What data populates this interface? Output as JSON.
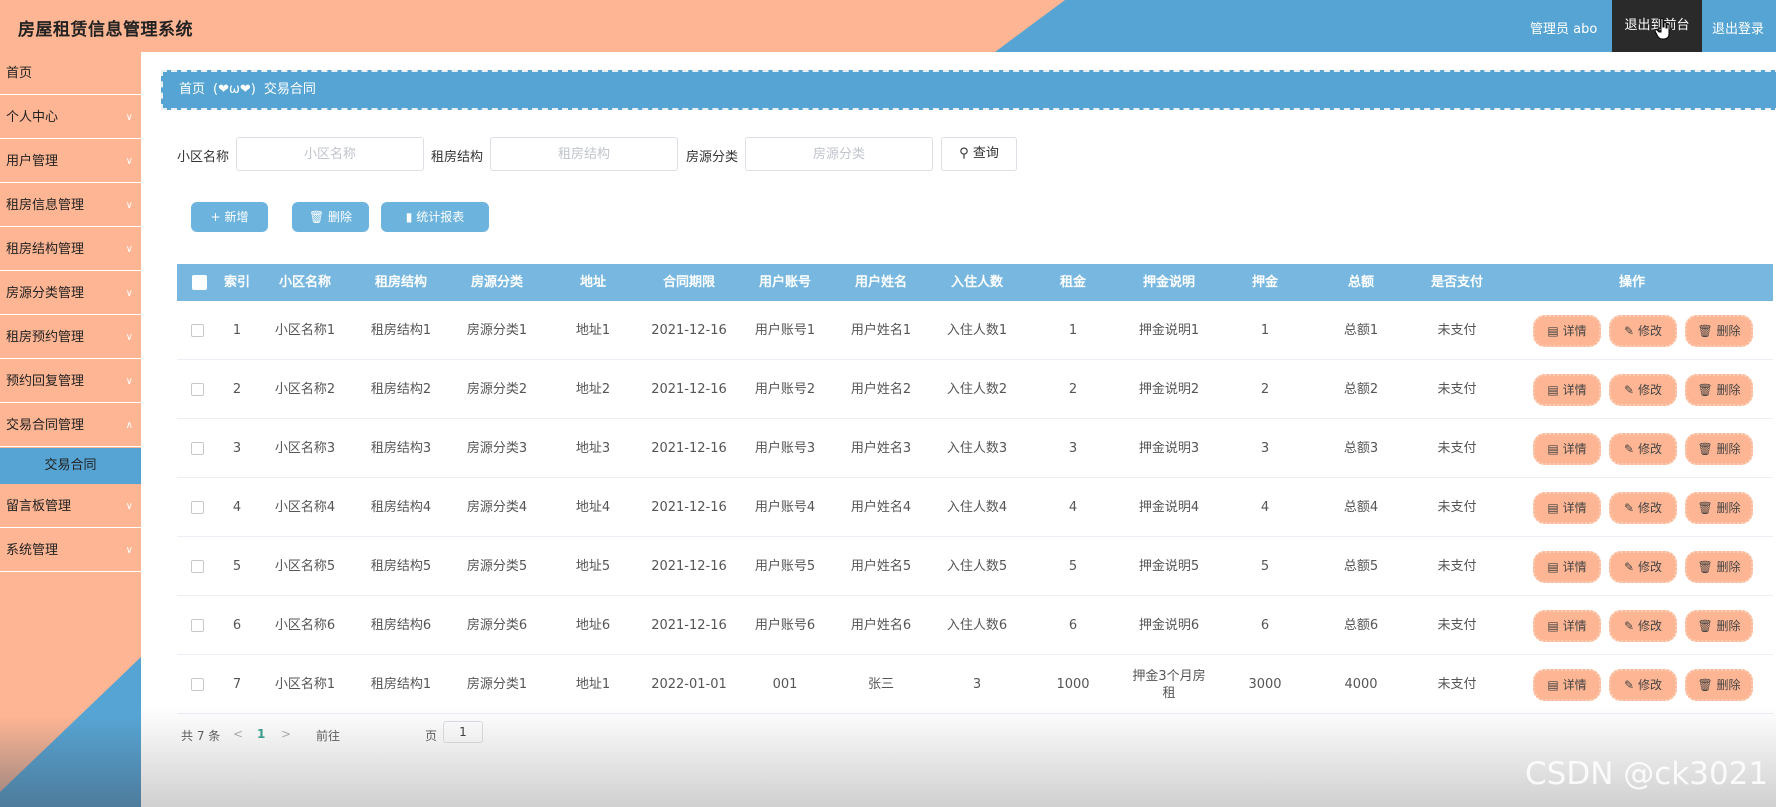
{
  "header": {
    "title": "房屋租赁信息管理系统",
    "admin_label": "管理员 abo",
    "backstage_label": "退出到前台",
    "logout_label": "退出登录"
  },
  "sidebar": {
    "items": [
      {
        "label": "首页"
      },
      {
        "label": "个人中心"
      },
      {
        "label": "用户管理"
      },
      {
        "label": "租房信息管理"
      },
      {
        "label": "租房结构管理"
      },
      {
        "label": "房源分类管理"
      },
      {
        "label": "租房预约管理"
      },
      {
        "label": "预约回复管理"
      },
      {
        "label": "交易合同管理"
      },
      {
        "label": "留言板管理"
      },
      {
        "label": "系统管理"
      }
    ],
    "active_sub": "交易合同"
  },
  "breadcrumb": {
    "home": "首页",
    "separator": "(❤ω❤)",
    "current": "交易合同"
  },
  "search": {
    "fields": [
      {
        "label": "小区名称",
        "placeholder": "小区名称"
      },
      {
        "label": "租房结构",
        "placeholder": "租房结构"
      },
      {
        "label": "房源分类",
        "placeholder": "房源分类"
      }
    ],
    "query_label": "查询"
  },
  "toolbar": {
    "add_label": "新增",
    "delete_label": "删除",
    "report_label": "统计报表"
  },
  "table": {
    "columns": [
      "索引",
      "小区名称",
      "租房结构",
      "房源分类",
      "地址",
      "合同期限",
      "用户账号",
      "用户姓名",
      "入住人数",
      "租金",
      "押金说明",
      "押金",
      "总额",
      "是否支付",
      "操作"
    ],
    "rows": [
      [
        "1",
        "小区名称1",
        "租房结构1",
        "房源分类1",
        "地址1",
        "2021-12-16",
        "用户账号1",
        "用户姓名1",
        "入住人数1",
        "1",
        "押金说明1",
        "1",
        "总额1",
        "未支付"
      ],
      [
        "2",
        "小区名称2",
        "租房结构2",
        "房源分类2",
        "地址2",
        "2021-12-16",
        "用户账号2",
        "用户姓名2",
        "入住人数2",
        "2",
        "押金说明2",
        "2",
        "总额2",
        "未支付"
      ],
      [
        "3",
        "小区名称3",
        "租房结构3",
        "房源分类3",
        "地址3",
        "2021-12-16",
        "用户账号3",
        "用户姓名3",
        "入住人数3",
        "3",
        "押金说明3",
        "3",
        "总额3",
        "未支付"
      ],
      [
        "4",
        "小区名称4",
        "租房结构4",
        "房源分类4",
        "地址4",
        "2021-12-16",
        "用户账号4",
        "用户姓名4",
        "入住人数4",
        "4",
        "押金说明4",
        "4",
        "总额4",
        "未支付"
      ],
      [
        "5",
        "小区名称5",
        "租房结构5",
        "房源分类5",
        "地址5",
        "2021-12-16",
        "用户账号5",
        "用户姓名5",
        "入住人数5",
        "5",
        "押金说明5",
        "5",
        "总额5",
        "未支付"
      ],
      [
        "6",
        "小区名称6",
        "租房结构6",
        "房源分类6",
        "地址6",
        "2021-12-16",
        "用户账号6",
        "用户姓名6",
        "入住人数6",
        "6",
        "押金说明6",
        "6",
        "总额6",
        "未支付"
      ],
      [
        "7",
        "小区名称1",
        "租房结构1",
        "房源分类1",
        "地址1",
        "2022-01-01",
        "001",
        "张三",
        "3",
        "1000",
        "押金3个月房租",
        "3000",
        "4000",
        "未支付"
      ]
    ],
    "op_labels": {
      "detail": "详情",
      "edit": "修改",
      "delete": "删除"
    }
  },
  "pagination": {
    "total_text": "共 7 条",
    "current_page": "1",
    "goto_label": "前往",
    "page_input": "1",
    "page_suffix": "页"
  },
  "watermark": "CSDN @ck3021",
  "colors": {
    "salmon": "#fdb593",
    "blue": "#56a4d3",
    "table_head": "#78b8e0",
    "dark_button": "#2a2a2a"
  }
}
